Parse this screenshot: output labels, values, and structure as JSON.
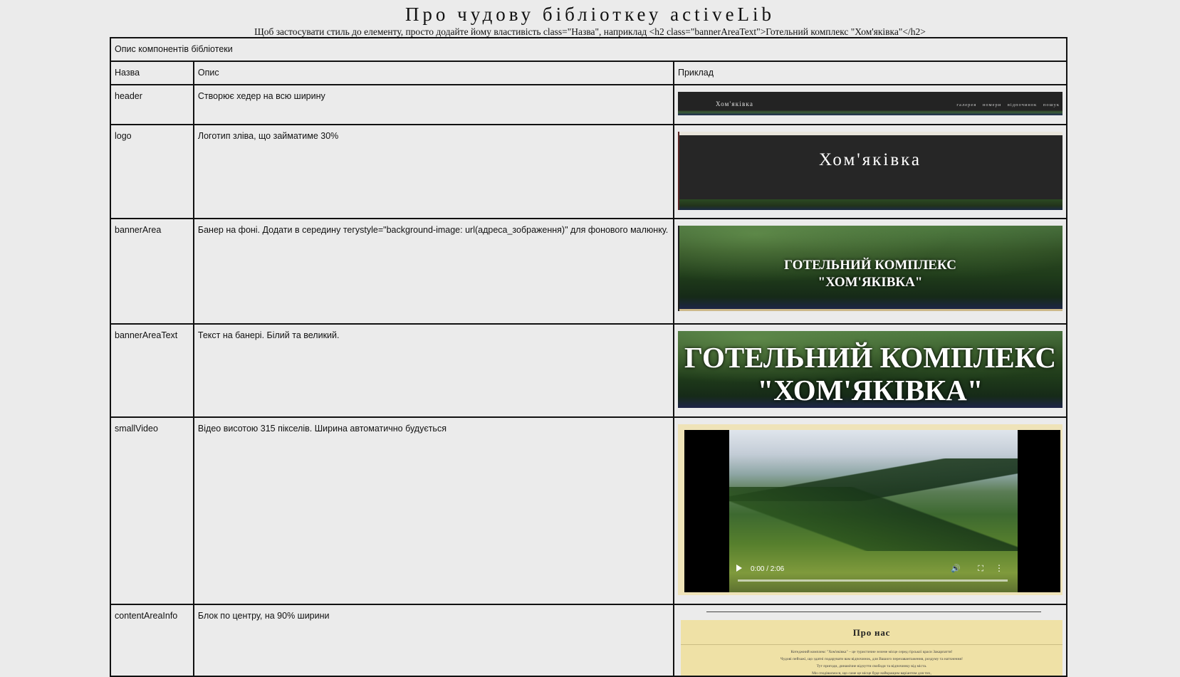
{
  "page": {
    "title": "Про чудову бібліоткеу activeLib",
    "subtitle": "Щоб застосувати стиль до елементу, просто додайте йому властивість class=\"Назва\", наприклад <h2 class=\"bannerAreaText\">Готельний комплекс \"Хом'яківка\"</h2>"
  },
  "table": {
    "caption": "Опис компонентів бібліотеки",
    "headers": {
      "name": "Назва",
      "desc": "Опис",
      "example": "Приклад"
    },
    "rows": [
      {
        "name": "header",
        "desc": "Створює хедер на всю ширину"
      },
      {
        "name": "logo",
        "desc": "Логотип зліва, що займатиме 30%"
      },
      {
        "name": "bannerArea",
        "desc": "Банер на фоні. Додати в середину тегуstyle=\"background-image: url(адреса_зображення)\" для фонового малюнку."
      },
      {
        "name": "bannerAreaText",
        "desc": "Текст на банері. Білий та великий."
      },
      {
        "name": "smallVideo",
        "desc": "Відео висотою 315 пікселів. Ширина автоматично будується"
      },
      {
        "name": "contentAreaInfo",
        "desc": "Блок по центру, на 90% ширини"
      }
    ]
  },
  "examples": {
    "header": {
      "brand": "Хом'яківка",
      "nav": "галерея номери відпочинок пошук"
    },
    "logo": {
      "text": "Хом'яківка"
    },
    "banner": {
      "line1": "ГОТЕЛЬНИЙ КОМПЛЕКС",
      "line2": "\"ХОМ'ЯКІВКА\""
    },
    "bannerText": {
      "line1": "ГОТЕЛЬНИЙ КОМПЛЕКС",
      "line2": "\"ХОМ'ЯКІВКА\""
    },
    "video": {
      "time": "0:00 / 2:06",
      "progress": 0,
      "icons": [
        "play-icon",
        "volume-icon",
        "fullscreen-icon",
        "more-options-icon"
      ]
    },
    "content": {
      "title": "Про нас",
      "body": [
        "Котеджний комплекс \"Хом'яківка\" – це туристичне зелене місце серед гірської краси Закарпаття!",
        "Чудові пейзажі, що здатні подарувати вам відпочинок, для Вашого перезавантаження, роздуму та натхнення!",
        "Тут пригоди, динамічне відчуття свободи та відпочинку від міста.",
        "Ми сподіваємося, що саме це місце буде найкращим варіантом для тих,"
      ]
    }
  },
  "colors": {
    "background": "#ebebeb",
    "border": "#111111",
    "header_bg": "#232323",
    "content_card": "#efe1a6"
  }
}
